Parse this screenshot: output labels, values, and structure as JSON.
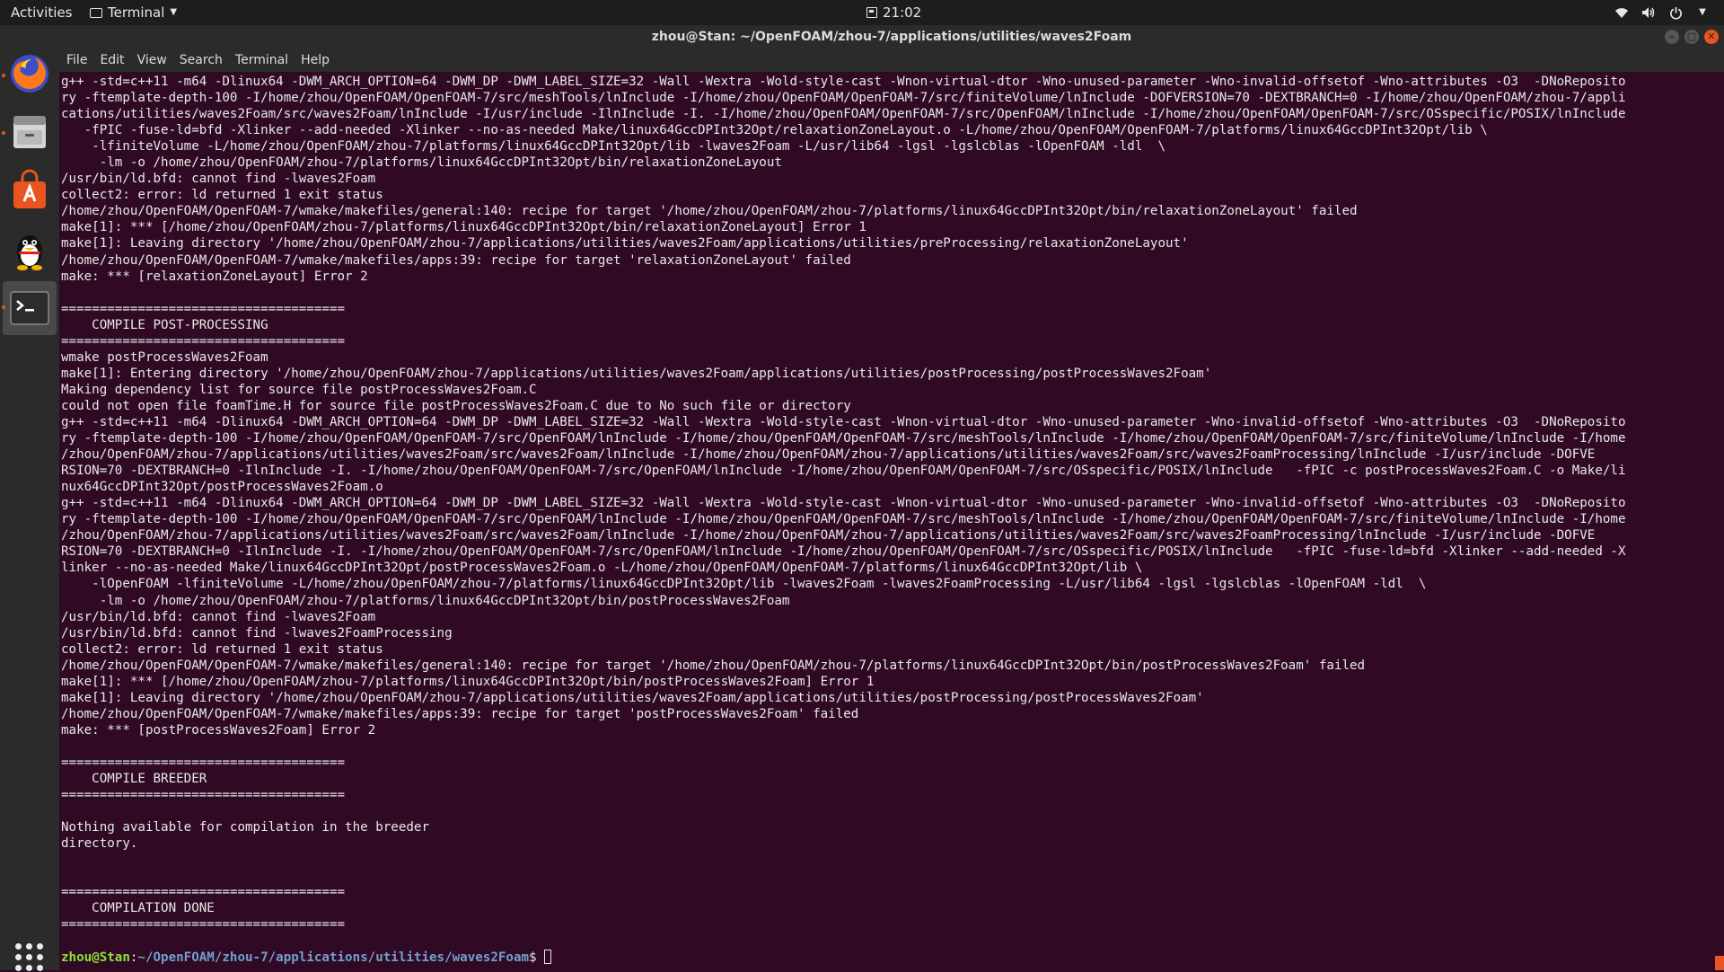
{
  "topbar": {
    "activities": "Activities",
    "app_menu": "Terminal",
    "clock": "21:02",
    "tray_icons": [
      "wifi-icon",
      "volume-icon",
      "power-icon",
      "chevron-down-icon"
    ]
  },
  "dock": {
    "apps": [
      "Firefox",
      "Files",
      "Ubuntu Software",
      "QQ",
      "Terminal"
    ],
    "show_apps": "Show Applications"
  },
  "window": {
    "title": "zhou@Stan: ~/OpenFOAM/zhou-7/applications/utilities/waves2Foam",
    "menu": [
      "File",
      "Edit",
      "View",
      "Search",
      "Terminal",
      "Help"
    ],
    "controls": [
      "minimize",
      "maximize",
      "close"
    ]
  },
  "terminal": {
    "lines": [
      "g++ -std=c++11 -m64 -Dlinux64 -DWM_ARCH_OPTION=64 -DWM_DP -DWM_LABEL_SIZE=32 -Wall -Wextra -Wold-style-cast -Wnon-virtual-dtor -Wno-unused-parameter -Wno-invalid-offsetof -Wno-attributes -O3  -DNoReposito",
      "ry -ftemplate-depth-100 -I/home/zhou/OpenFOAM/OpenFOAM-7/src/meshTools/lnInclude -I/home/zhou/OpenFOAM/OpenFOAM-7/src/finiteVolume/lnInclude -DOFVERSION=70 -DEXTBRANCH=0 -I/home/zhou/OpenFOAM/zhou-7/appli",
      "cations/utilities/waves2Foam/src/waves2Foam/lnInclude -I/usr/include -IlnInclude -I. -I/home/zhou/OpenFOAM/OpenFOAM-7/src/OpenFOAM/lnInclude -I/home/zhou/OpenFOAM/OpenFOAM-7/src/OSspecific/POSIX/lnInclude",
      "   -fPIC -fuse-ld=bfd -Xlinker --add-needed -Xlinker --no-as-needed Make/linux64GccDPInt32Opt/relaxationZoneLayout.o -L/home/zhou/OpenFOAM/OpenFOAM-7/platforms/linux64GccDPInt32Opt/lib \\",
      "    -lfiniteVolume -L/home/zhou/OpenFOAM/zhou-7/platforms/linux64GccDPInt32Opt/lib -lwaves2Foam -L/usr/lib64 -lgsl -lgslcblas -lOpenFOAM -ldl  \\",
      "     -lm -o /home/zhou/OpenFOAM/zhou-7/platforms/linux64GccDPInt32Opt/bin/relaxationZoneLayout",
      "/usr/bin/ld.bfd: cannot find -lwaves2Foam",
      "collect2: error: ld returned 1 exit status",
      "/home/zhou/OpenFOAM/OpenFOAM-7/wmake/makefiles/general:140: recipe for target '/home/zhou/OpenFOAM/zhou-7/platforms/linux64GccDPInt32Opt/bin/relaxationZoneLayout' failed",
      "make[1]: *** [/home/zhou/OpenFOAM/zhou-7/platforms/linux64GccDPInt32Opt/bin/relaxationZoneLayout] Error 1",
      "make[1]: Leaving directory '/home/zhou/OpenFOAM/zhou-7/applications/utilities/waves2Foam/applications/utilities/preProcessing/relaxationZoneLayout'",
      "/home/zhou/OpenFOAM/OpenFOAM-7/wmake/makefiles/apps:39: recipe for target 'relaxationZoneLayout' failed",
      "make: *** [relaxationZoneLayout] Error 2",
      "",
      "=====================================",
      "    COMPILE POST-PROCESSING",
      "=====================================",
      "wmake postProcessWaves2Foam",
      "make[1]: Entering directory '/home/zhou/OpenFOAM/zhou-7/applications/utilities/waves2Foam/applications/utilities/postProcessing/postProcessWaves2Foam'",
      "Making dependency list for source file postProcessWaves2Foam.C",
      "could not open file foamTime.H for source file postProcessWaves2Foam.C due to No such file or directory",
      "g++ -std=c++11 -m64 -Dlinux64 -DWM_ARCH_OPTION=64 -DWM_DP -DWM_LABEL_SIZE=32 -Wall -Wextra -Wold-style-cast -Wnon-virtual-dtor -Wno-unused-parameter -Wno-invalid-offsetof -Wno-attributes -O3  -DNoReposito",
      "ry -ftemplate-depth-100 -I/home/zhou/OpenFOAM/OpenFOAM-7/src/OpenFOAM/lnInclude -I/home/zhou/OpenFOAM/OpenFOAM-7/src/meshTools/lnInclude -I/home/zhou/OpenFOAM/OpenFOAM-7/src/finiteVolume/lnInclude -I/home",
      "/zhou/OpenFOAM/zhou-7/applications/utilities/waves2Foam/src/waves2Foam/lnInclude -I/home/zhou/OpenFOAM/zhou-7/applications/utilities/waves2Foam/src/waves2FoamProcessing/lnInclude -I/usr/include -DOFVE",
      "RSION=70 -DEXTBRANCH=0 -IlnInclude -I. -I/home/zhou/OpenFOAM/OpenFOAM-7/src/OpenFOAM/lnInclude -I/home/zhou/OpenFOAM/OpenFOAM-7/src/OSspecific/POSIX/lnInclude   -fPIC -c postProcessWaves2Foam.C -o Make/li",
      "nux64GccDPInt32Opt/postProcessWaves2Foam.o",
      "g++ -std=c++11 -m64 -Dlinux64 -DWM_ARCH_OPTION=64 -DWM_DP -DWM_LABEL_SIZE=32 -Wall -Wextra -Wold-style-cast -Wnon-virtual-dtor -Wno-unused-parameter -Wno-invalid-offsetof -Wno-attributes -O3  -DNoReposito",
      "ry -ftemplate-depth-100 -I/home/zhou/OpenFOAM/OpenFOAM-7/src/OpenFOAM/lnInclude -I/home/zhou/OpenFOAM/OpenFOAM-7/src/meshTools/lnInclude -I/home/zhou/OpenFOAM/OpenFOAM-7/src/finiteVolume/lnInclude -I/home",
      "/zhou/OpenFOAM/zhou-7/applications/utilities/waves2Foam/src/waves2Foam/lnInclude -I/home/zhou/OpenFOAM/zhou-7/applications/utilities/waves2Foam/src/waves2FoamProcessing/lnInclude -I/usr/include -DOFVE",
      "RSION=70 -DEXTBRANCH=0 -IlnInclude -I. -I/home/zhou/OpenFOAM/OpenFOAM-7/src/OpenFOAM/lnInclude -I/home/zhou/OpenFOAM/OpenFOAM-7/src/OSspecific/POSIX/lnInclude   -fPIC -fuse-ld=bfd -Xlinker --add-needed -X",
      "linker --no-as-needed Make/linux64GccDPInt32Opt/postProcessWaves2Foam.o -L/home/zhou/OpenFOAM/OpenFOAM-7/platforms/linux64GccDPInt32Opt/lib \\",
      "    -lOpenFOAM -lfiniteVolume -L/home/zhou/OpenFOAM/zhou-7/platforms/linux64GccDPInt32Opt/lib -lwaves2Foam -lwaves2FoamProcessing -L/usr/lib64 -lgsl -lgslcblas -lOpenFOAM -ldl  \\",
      "     -lm -o /home/zhou/OpenFOAM/zhou-7/platforms/linux64GccDPInt32Opt/bin/postProcessWaves2Foam",
      "/usr/bin/ld.bfd: cannot find -lwaves2Foam",
      "/usr/bin/ld.bfd: cannot find -lwaves2FoamProcessing",
      "collect2: error: ld returned 1 exit status",
      "/home/zhou/OpenFOAM/OpenFOAM-7/wmake/makefiles/general:140: recipe for target '/home/zhou/OpenFOAM/zhou-7/platforms/linux64GccDPInt32Opt/bin/postProcessWaves2Foam' failed",
      "make[1]: *** [/home/zhou/OpenFOAM/zhou-7/platforms/linux64GccDPInt32Opt/bin/postProcessWaves2Foam] Error 1",
      "make[1]: Leaving directory '/home/zhou/OpenFOAM/zhou-7/applications/utilities/waves2Foam/applications/utilities/postProcessing/postProcessWaves2Foam'",
      "/home/zhou/OpenFOAM/OpenFOAM-7/wmake/makefiles/apps:39: recipe for target 'postProcessWaves2Foam' failed",
      "make: *** [postProcessWaves2Foam] Error 2",
      "",
      "=====================================",
      "    COMPILE BREEDER",
      "=====================================",
      "",
      "Nothing available for compilation in the breeder",
      "directory.",
      "",
      "",
      "=====================================",
      "    COMPILATION DONE",
      "=====================================",
      ""
    ],
    "prompt_user": "zhou@Stan",
    "prompt_sep": ":",
    "prompt_path": "~/OpenFOAM/zhou-7/applications/utilities/waves2Foam",
    "prompt_symbol": "$ "
  },
  "colors": {
    "terminal_bg": "#300a24",
    "prompt_user": "#8ae234",
    "prompt_path": "#729fcf",
    "accent": "#e95420"
  }
}
